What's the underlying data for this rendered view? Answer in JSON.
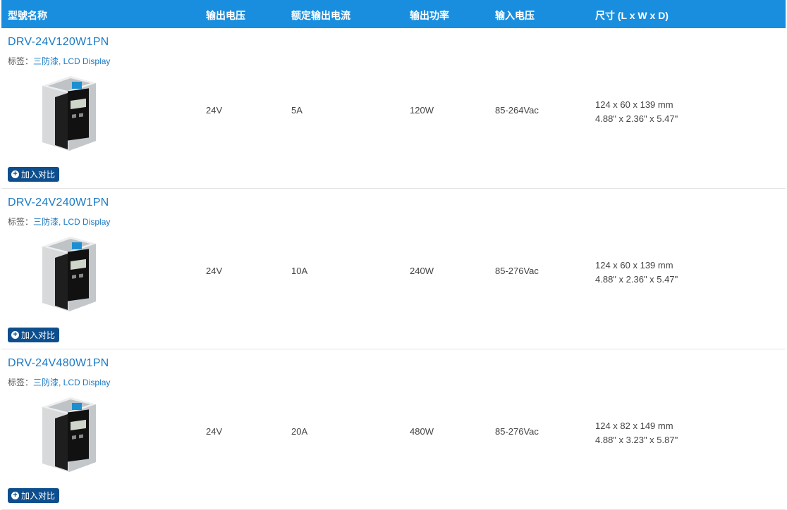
{
  "header": {
    "col_model": "型號名称",
    "col_output_voltage": "输出电压",
    "col_rated_current": "额定输出电流",
    "col_output_power": "输出功率",
    "col_input_voltage": "输入电压",
    "col_dimensions": "尺寸 (L x W x D)"
  },
  "tag_prefix": "标签：",
  "compare_label": "加入对比",
  "products": [
    {
      "model": "DRV-24V120W1PN",
      "tags": "三防漆, LCD Display",
      "output_voltage": "24V",
      "rated_current": "5A",
      "output_power": "120W",
      "input_voltage": "85-264Vac",
      "dim_mm": "124 x 60 x 139 mm",
      "dim_in": "4.88\" x 2.36\" x 5.47\""
    },
    {
      "model": "DRV-24V240W1PN",
      "tags": "三防漆, LCD Display",
      "output_voltage": "24V",
      "rated_current": "10A",
      "output_power": "240W",
      "input_voltage": "85-276Vac",
      "dim_mm": "124 x 60 x 139 mm",
      "dim_in": "4.88\" x 2.36\" x 5.47\""
    },
    {
      "model": "DRV-24V480W1PN",
      "tags": "三防漆, LCD Display",
      "output_voltage": "24V",
      "rated_current": "20A",
      "output_power": "480W",
      "input_voltage": "85-276Vac",
      "dim_mm": "124 x 82 x 149 mm",
      "dim_in": "4.88\" x 3.23\" x 5.87\""
    }
  ]
}
